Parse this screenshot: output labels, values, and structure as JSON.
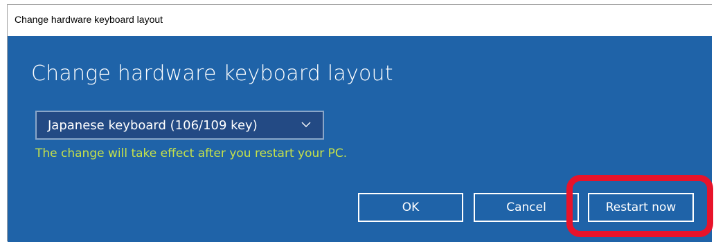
{
  "window": {
    "title": "Change hardware keyboard layout"
  },
  "dialog": {
    "heading": "Change hardware keyboard layout",
    "layout_select": {
      "selected": "Japanese keyboard (106/109 key)",
      "icon": "chevron-down-icon"
    },
    "notice": "The change will take effect after you restart your PC.",
    "buttons": {
      "ok": "OK",
      "cancel": "Cancel",
      "restart": "Restart now"
    }
  },
  "colors": {
    "background": "#1f63a8",
    "dropdown_background": "#234a84",
    "notice_text": "#c5e14a",
    "button_border": "#ffffff",
    "highlight_annotation": "#e8132a"
  }
}
